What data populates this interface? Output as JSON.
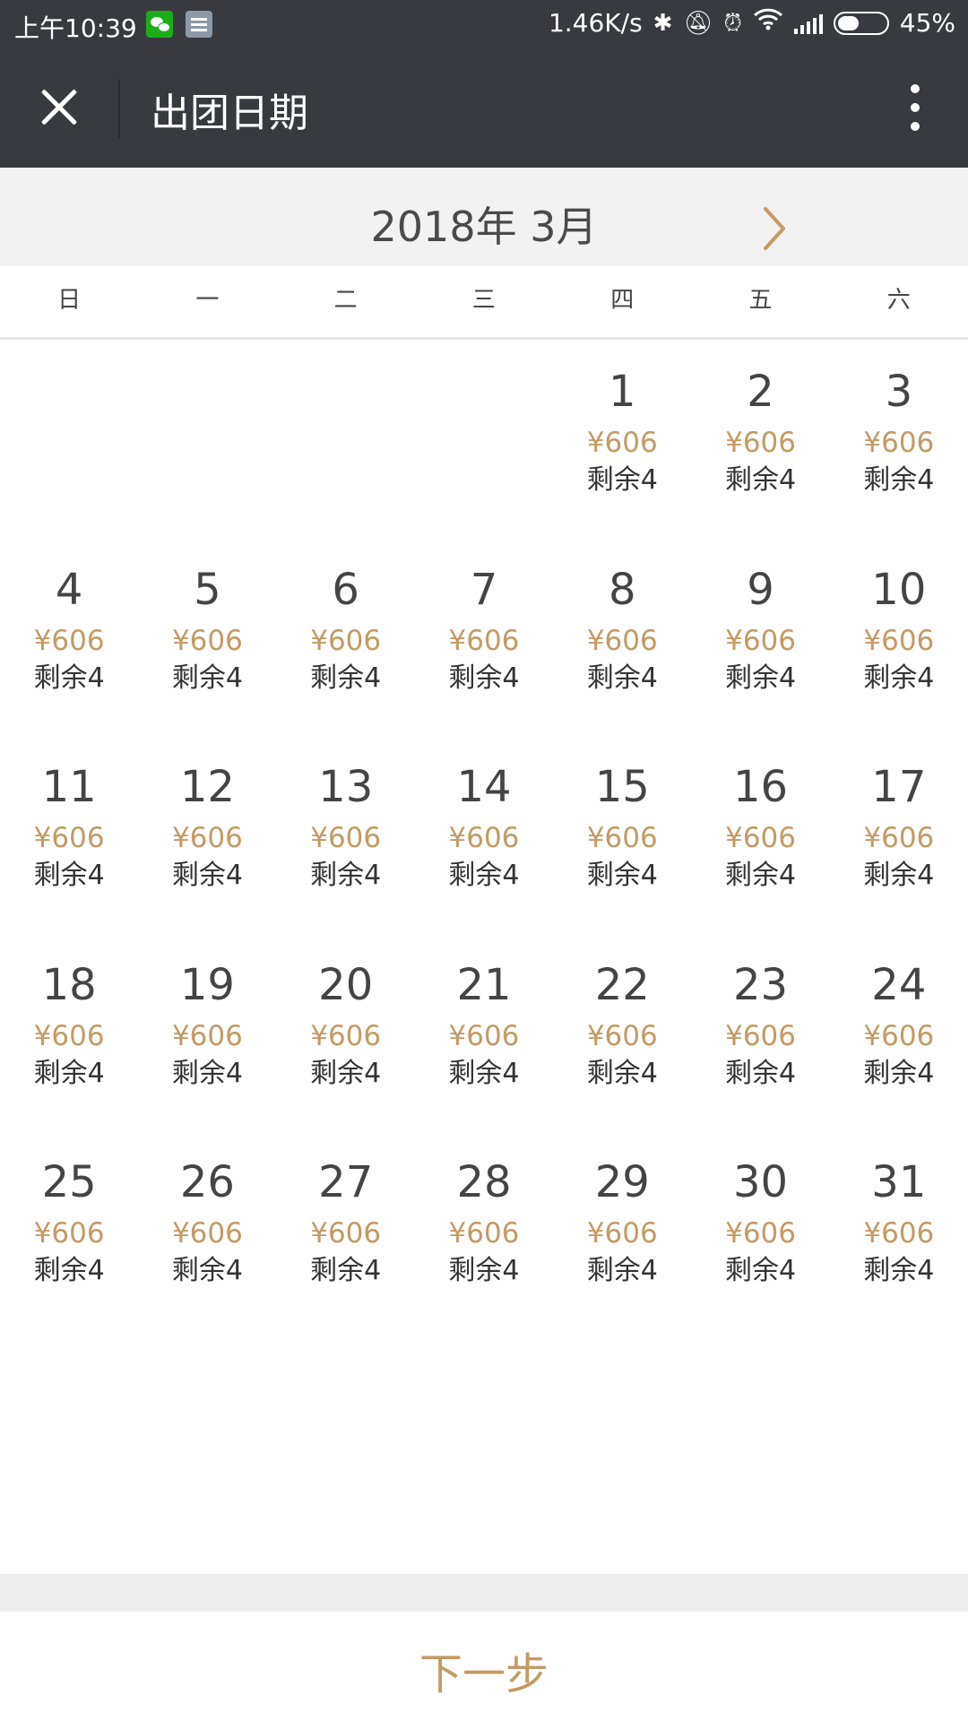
{
  "status_bar": {
    "time": "上午10:39",
    "net_speed": "1.46K/s",
    "battery_text": "45%",
    "battery_level": 0.45,
    "icons": [
      "wechat-icon",
      "notes-icon",
      "bluetooth-icon",
      "mute-icon",
      "alarm-icon",
      "wifi-icon",
      "signal-icon",
      "battery-icon"
    ]
  },
  "header": {
    "title": "出团日期"
  },
  "calendar": {
    "month_label": "2018年 3月",
    "weekdays": [
      "日",
      "一",
      "二",
      "三",
      "四",
      "五",
      "六"
    ],
    "first_weekday_index": 4,
    "days": [
      {
        "day": "1",
        "price": "¥606",
        "remain": "剩余4"
      },
      {
        "day": "2",
        "price": "¥606",
        "remain": "剩余4"
      },
      {
        "day": "3",
        "price": "¥606",
        "remain": "剩余4"
      },
      {
        "day": "4",
        "price": "¥606",
        "remain": "剩余4"
      },
      {
        "day": "5",
        "price": "¥606",
        "remain": "剩余4"
      },
      {
        "day": "6",
        "price": "¥606",
        "remain": "剩余4"
      },
      {
        "day": "7",
        "price": "¥606",
        "remain": "剩余4"
      },
      {
        "day": "8",
        "price": "¥606",
        "remain": "剩余4"
      },
      {
        "day": "9",
        "price": "¥606",
        "remain": "剩余4"
      },
      {
        "day": "10",
        "price": "¥606",
        "remain": "剩余4"
      },
      {
        "day": "11",
        "price": "¥606",
        "remain": "剩余4"
      },
      {
        "day": "12",
        "price": "¥606",
        "remain": "剩余4"
      },
      {
        "day": "13",
        "price": "¥606",
        "remain": "剩余4"
      },
      {
        "day": "14",
        "price": "¥606",
        "remain": "剩余4"
      },
      {
        "day": "15",
        "price": "¥606",
        "remain": "剩余4"
      },
      {
        "day": "16",
        "price": "¥606",
        "remain": "剩余4"
      },
      {
        "day": "17",
        "price": "¥606",
        "remain": "剩余4"
      },
      {
        "day": "18",
        "price": "¥606",
        "remain": "剩余4"
      },
      {
        "day": "19",
        "price": "¥606",
        "remain": "剩余4"
      },
      {
        "day": "20",
        "price": "¥606",
        "remain": "剩余4"
      },
      {
        "day": "21",
        "price": "¥606",
        "remain": "剩余4"
      },
      {
        "day": "22",
        "price": "¥606",
        "remain": "剩余4"
      },
      {
        "day": "23",
        "price": "¥606",
        "remain": "剩余4"
      },
      {
        "day": "24",
        "price": "¥606",
        "remain": "剩余4"
      },
      {
        "day": "25",
        "price": "¥606",
        "remain": "剩余4"
      },
      {
        "day": "26",
        "price": "¥606",
        "remain": "剩余4"
      },
      {
        "day": "27",
        "price": "¥606",
        "remain": "剩余4"
      },
      {
        "day": "28",
        "price": "¥606",
        "remain": "剩余4"
      },
      {
        "day": "29",
        "price": "¥606",
        "remain": "剩余4"
      },
      {
        "day": "30",
        "price": "¥606",
        "remain": "剩余4"
      },
      {
        "day": "31",
        "price": "¥606",
        "remain": "剩余4"
      }
    ]
  },
  "footer": {
    "next_label": "下一步"
  },
  "colors": {
    "bar_bg": "#393a3f",
    "accent": "#c49a65",
    "month_bg": "#f2f2f2"
  }
}
